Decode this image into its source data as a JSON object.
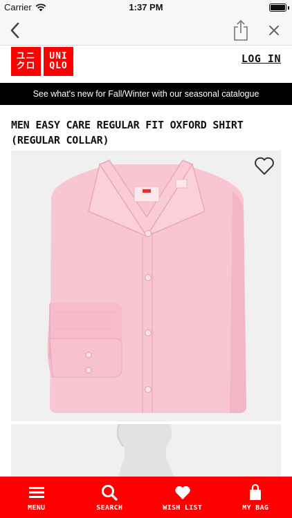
{
  "status_bar": {
    "carrier": "Carrier",
    "time": "1:37 PM"
  },
  "nav": {
    "back_icon": "chevron-left-icon",
    "share_icon": "share-icon",
    "close_icon": "close-icon"
  },
  "header": {
    "logo_left": [
      "ユニ",
      "クロ"
    ],
    "logo_right": [
      "UNI",
      "QLO"
    ],
    "login_label": "LOG IN"
  },
  "promo": {
    "text": "See what's new for Fall/Winter with our seasonal catalogue"
  },
  "product": {
    "title_line1": "MEN EASY CARE REGULAR FIT OXFORD SHIRT",
    "title_line2": "(REGULAR COLLAR)",
    "image_label": "pink oxford shirt",
    "wish_icon": "heart-outline-icon"
  },
  "tab_bar": {
    "items": [
      {
        "label": "MENU",
        "icon": "menu-icon"
      },
      {
        "label": "SEARCH",
        "icon": "search-icon"
      },
      {
        "label": "WISH LIST",
        "icon": "heart-icon"
      },
      {
        "label": "MY BAG",
        "icon": "bag-icon"
      }
    ]
  },
  "colors": {
    "brand_red": "#ff0000",
    "banner_bg": "#000000",
    "image_bg": "#f0f0f0",
    "shirt_pink": "#f8c6d3"
  }
}
